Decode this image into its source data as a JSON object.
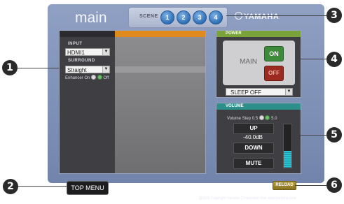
{
  "header": {
    "title": "main",
    "brand": "YAMAHA"
  },
  "scene": {
    "label": "SCENE",
    "buttons": [
      "1",
      "2",
      "3",
      "4"
    ]
  },
  "input_panel": {
    "input_label": "INPUT",
    "input_value": "HDMI1",
    "surround_label": "SURROUND",
    "surround_value": "Straight",
    "enhancer_label": "Enhancer",
    "enhancer_on": "On",
    "enhancer_off": "Off",
    "enhancer_state": "Off"
  },
  "power": {
    "title": "POWER",
    "main_label": "MAIN",
    "on_label": "ON",
    "off_label": "OFF",
    "sleep_value": "SLEEP OFF"
  },
  "volume": {
    "title": "VOLUME",
    "step_label": "Volume Step",
    "step_options": [
      "0.5",
      "5.0"
    ],
    "step_selected": "5.0",
    "up_label": "UP",
    "value": "-40.0dB",
    "down_label": "DOWN",
    "mute_label": "MUTE",
    "meter_level": 0.38
  },
  "footer": {
    "top_menu": "TOP MENU",
    "reload": "RELOAD",
    "copyright": "@2011 Copyright Yamaha Corporation Visit www.yamaha.com"
  },
  "callouts": [
    "1",
    "2",
    "3",
    "4",
    "5",
    "6"
  ],
  "colors": {
    "accent_orange": "#e08a1e",
    "power_green": "#7aa33a",
    "volume_teal": "#2c8f8a",
    "scene_blue": "#2f6fb6"
  }
}
